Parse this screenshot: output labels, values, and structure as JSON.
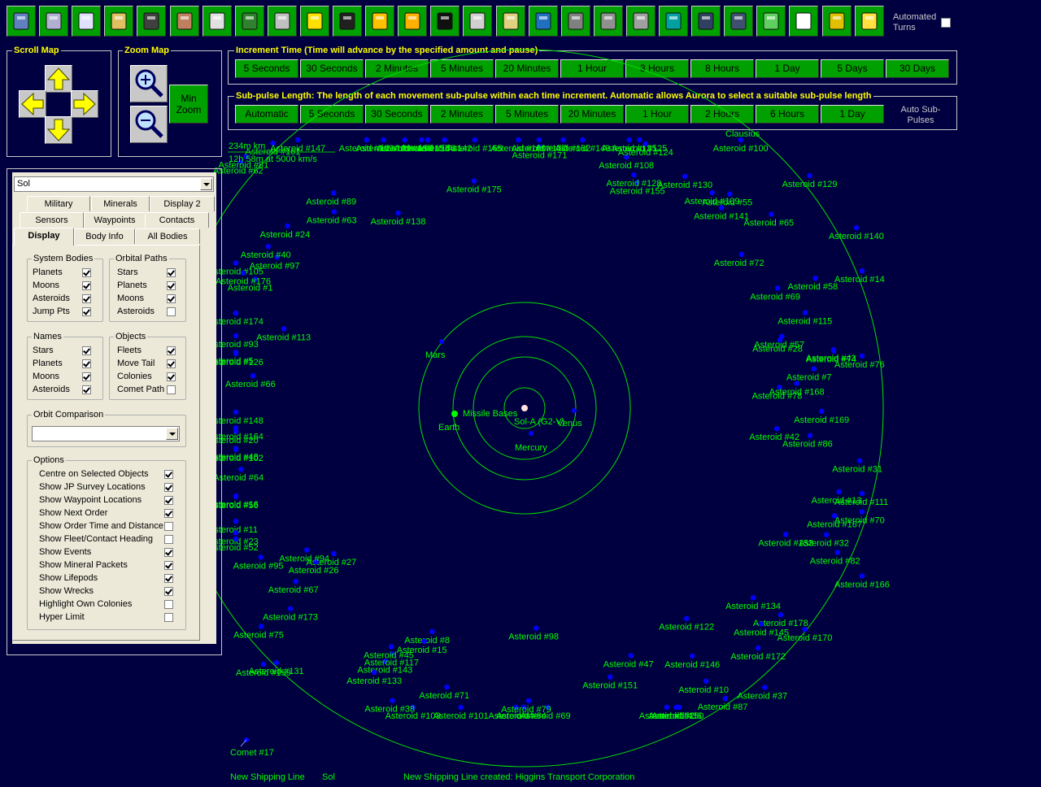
{
  "toolbar": {
    "buttons": [
      "colony-summary",
      "industry",
      "research",
      "wealth",
      "ground-forces",
      "commanders",
      "class-design",
      "ship-design",
      "missile-design",
      "turret-design",
      "fleets",
      "system-gen",
      "sun",
      "system-view",
      "alien",
      "intelligence",
      "galactic-map",
      "stockpile",
      "repair",
      "buildings",
      "ship-list",
      "planets",
      "event-log",
      "tech-tree",
      "refresh",
      "events",
      "gear"
    ],
    "automated_turns_label": "Automated Turns",
    "automated_turns": false
  },
  "scroll_map": {
    "title": "Scroll Map"
  },
  "zoom_map": {
    "title": "Zoom Map",
    "min_zoom_label": "Min Zoom"
  },
  "increment": {
    "title": "Increment Time (Time will advance by the specified amount and pause)",
    "buttons": [
      "5 Seconds",
      "30 Seconds",
      "2 Minutes",
      "5 Minutes",
      "20 Minutes",
      "1 Hour",
      "3 Hours",
      "8 Hours",
      "1 Day",
      "5 Days",
      "30 Days"
    ]
  },
  "subpulse": {
    "title": "Sub-pulse Length: The length of each movement sub-pulse within each time increment. Automatic allows Aurora to select a suitable sub-pulse length",
    "buttons": [
      "Automatic",
      "5 Seconds",
      "30 Seconds",
      "2 Minutes",
      "5 Minutes",
      "20 Minutes",
      "1 Hour",
      "2 Hours",
      "6 Hours",
      "1 Day"
    ],
    "auto_label": "Auto Sub-Pulses"
  },
  "system_select": "Sol",
  "tabs": {
    "row1": [
      "Military",
      "Minerals",
      "Display 2"
    ],
    "row2": [
      "Sensors",
      "Waypoints",
      "Contacts"
    ],
    "row3": [
      "Display",
      "Body Info",
      "All Bodies"
    ]
  },
  "system_bodies": {
    "title": "System Bodies",
    "items": [
      {
        "label": "Planets",
        "on": true
      },
      {
        "label": "Moons",
        "on": true
      },
      {
        "label": "Asteroids",
        "on": true
      },
      {
        "label": "Jump Pts",
        "on": true
      }
    ]
  },
  "orbital_paths": {
    "title": "Orbital Paths",
    "items": [
      {
        "label": "Stars",
        "on": true
      },
      {
        "label": "Planets",
        "on": true
      },
      {
        "label": "Moons",
        "on": true
      },
      {
        "label": "Asteroids",
        "on": false
      }
    ]
  },
  "names": {
    "title": "Names",
    "items": [
      {
        "label": "Stars",
        "on": true
      },
      {
        "label": "Planets",
        "on": true
      },
      {
        "label": "Moons",
        "on": true
      },
      {
        "label": "Asteroids",
        "on": true
      }
    ]
  },
  "objects": {
    "title": "Objects",
    "items": [
      {
        "label": "Fleets",
        "on": true
      },
      {
        "label": "Move Tail",
        "on": true
      },
      {
        "label": "Colonies",
        "on": true
      },
      {
        "label": "Comet Path",
        "on": false
      }
    ]
  },
  "orbit_comparison": {
    "title": "Orbit Comparison",
    "value": ""
  },
  "options": {
    "title": "Options",
    "items": [
      {
        "label": "Centre on Selected Objects",
        "on": true
      },
      {
        "label": "Show JP Survey Locations",
        "on": true
      },
      {
        "label": "Show Waypoint Locations",
        "on": true
      },
      {
        "label": "Show Next Order",
        "on": true
      },
      {
        "label": "Show Order Time and Distance",
        "on": false
      },
      {
        "label": "Show Fleet/Contact Heading",
        "on": false
      },
      {
        "label": "Show Events",
        "on": true
      },
      {
        "label": "Show Mineral Packets",
        "on": true
      },
      {
        "label": "Show Lifepods",
        "on": true
      },
      {
        "label": "Show Wrecks",
        "on": true
      },
      {
        "label": "Highlight Own Colonies",
        "on": false
      },
      {
        "label": "Hyper Limit",
        "on": false
      }
    ]
  },
  "map": {
    "scale": "234m km",
    "travel": "12h 58m at 5000 km/s",
    "bodies": [
      {
        "name": "Sol-A (G2-V)",
        "type": "star"
      },
      {
        "name": "Mercury",
        "type": "planet"
      },
      {
        "name": "Venus",
        "type": "planet"
      },
      {
        "name": "Earth",
        "type": "planet",
        "colony": "Missile Bases"
      },
      {
        "name": "Mars",
        "type": "planet"
      },
      {
        "name": "Comet #17",
        "type": "comet"
      },
      {
        "name": "Clausius",
        "type": "other"
      }
    ],
    "asteroids": [
      {
        "name": "Asteroid #171"
      },
      {
        "name": "Asteroid #162"
      },
      {
        "name": "Asteroid #149"
      },
      {
        "name": "Asteroid #177"
      },
      {
        "name": "Asteroid #135"
      },
      {
        "name": "Asteroid #108"
      },
      {
        "name": "Asteroid #155"
      },
      {
        "name": "Asteroid #128"
      },
      {
        "name": "Asteroid #125"
      },
      {
        "name": "Asteroid #100"
      },
      {
        "name": "Asteroid #124"
      },
      {
        "name": "Asteroid #109"
      },
      {
        "name": "Asteroid #130"
      },
      {
        "name": "Asteroid #129"
      },
      {
        "name": "Asteroid #55"
      },
      {
        "name": "Asteroid #72"
      },
      {
        "name": "Asteroid #141"
      },
      {
        "name": "Asteroid #65"
      },
      {
        "name": "Asteroid #58"
      },
      {
        "name": "Asteroid #69"
      },
      {
        "name": "Asteroid #140"
      },
      {
        "name": "Asteroid #115"
      },
      {
        "name": "Asteroid #14"
      },
      {
        "name": "Asteroid #57"
      },
      {
        "name": "Asteroid #28"
      },
      {
        "name": "Asteroid #74"
      },
      {
        "name": "Asteroid #7"
      },
      {
        "name": "Asteroid #43"
      },
      {
        "name": "Asteroid #76"
      },
      {
        "name": "Asteroid #78"
      },
      {
        "name": "Asteroid #168"
      },
      {
        "name": "Asteroid #42"
      },
      {
        "name": "Asteroid #169"
      },
      {
        "name": "Asteroid #86"
      },
      {
        "name": "Asteroid #13"
      },
      {
        "name": "Asteroid #111"
      },
      {
        "name": "Asteroid #70"
      },
      {
        "name": "Asteroid #31"
      },
      {
        "name": "Asteroid #167"
      },
      {
        "name": "Asteroid #153"
      },
      {
        "name": "Asteroid #166"
      },
      {
        "name": "Asteroid #32"
      },
      {
        "name": "Asteroid #178"
      },
      {
        "name": "Asteroid #82"
      },
      {
        "name": "Asteroid #134"
      },
      {
        "name": "Asteroid #172"
      },
      {
        "name": "Asteroid #170"
      },
      {
        "name": "Asteroid #146"
      },
      {
        "name": "Asteroid #145"
      },
      {
        "name": "Asteroid #87"
      },
      {
        "name": "Asteroid #10"
      },
      {
        "name": "Asteroid #37"
      },
      {
        "name": "Asteroid #122"
      },
      {
        "name": "Asteroid #150"
      },
      {
        "name": "Asteroid #36"
      },
      {
        "name": "Asteroid #152"
      },
      {
        "name": "Asteroid #151"
      },
      {
        "name": "Asteroid #47"
      },
      {
        "name": "Asteroid #69"
      },
      {
        "name": "Asteroid #4"
      },
      {
        "name": "Asteroid #84"
      },
      {
        "name": "Asteroid #98"
      },
      {
        "name": "Asteroid #79"
      },
      {
        "name": "Asteroid #101"
      },
      {
        "name": "Asteroid #71"
      },
      {
        "name": "Asteroid #103"
      },
      {
        "name": "Asteroid #8"
      },
      {
        "name": "Asteroid #15"
      },
      {
        "name": "Asteroid #143"
      },
      {
        "name": "Asteroid #38"
      },
      {
        "name": "Asteroid #117"
      },
      {
        "name": "Asteroid #45"
      },
      {
        "name": "Asteroid #133"
      },
      {
        "name": "Asteroid #75"
      },
      {
        "name": "Asteroid #131"
      },
      {
        "name": "Asteroid #67"
      },
      {
        "name": "Asteroid #173"
      },
      {
        "name": "Asteroid #159"
      },
      {
        "name": "Asteroid #27"
      },
      {
        "name": "Asteroid #95"
      },
      {
        "name": "Asteroid #26"
      },
      {
        "name": "Asteroid #94"
      },
      {
        "name": "Asteroid #11"
      },
      {
        "name": "Asteroid #56"
      },
      {
        "name": "Asteroid #23"
      },
      {
        "name": "Asteroid #48"
      },
      {
        "name": "Asteroid #52"
      },
      {
        "name": "Asteroid #16"
      },
      {
        "name": "Asteroid #64"
      },
      {
        "name": "Asteroid #20"
      },
      {
        "name": "Asteroid #102"
      },
      {
        "name": "Asteroid #164"
      },
      {
        "name": "Asteroid #148"
      },
      {
        "name": "Asteroid #5"
      },
      {
        "name": "Asteroid #93"
      },
      {
        "name": "Asteroid #66"
      },
      {
        "name": "Asteroid #113"
      },
      {
        "name": "Asteroid #126"
      },
      {
        "name": "Asteroid #174"
      },
      {
        "name": "Asteroid #105"
      },
      {
        "name": "Asteroid #1"
      },
      {
        "name": "Asteroid #176"
      },
      {
        "name": "Asteroid #97"
      },
      {
        "name": "Asteroid #62"
      },
      {
        "name": "Asteroid #24"
      },
      {
        "name": "Asteroid #63"
      },
      {
        "name": "Asteroid #40"
      },
      {
        "name": "Asteroid #81"
      },
      {
        "name": "Asteroid #138"
      },
      {
        "name": "Asteroid #89"
      },
      {
        "name": "Asteroid #161"
      },
      {
        "name": "Asteroid #147"
      },
      {
        "name": "Asteroid #119"
      },
      {
        "name": "Asteroid #157"
      },
      {
        "name": "Asteroid #137"
      },
      {
        "name": "Asteroid #139"
      },
      {
        "name": "Asteroid #142"
      },
      {
        "name": "Asteroid #175"
      },
      {
        "name": "Asteroid #160"
      },
      {
        "name": "Asteroid #158"
      },
      {
        "name": "Asteroid #165"
      }
    ]
  },
  "status_bar": {
    "left": "New Shipping Line",
    "system": "Sol",
    "message": "New Shipping Line created: Higgins Transport Corporation"
  },
  "colors": {
    "background": "#000040",
    "button": "#00a000",
    "map_label": "#00ff00",
    "asteroid": "#0000ff",
    "frame_title": "#ffff00",
    "panel": "#ece9d8"
  }
}
